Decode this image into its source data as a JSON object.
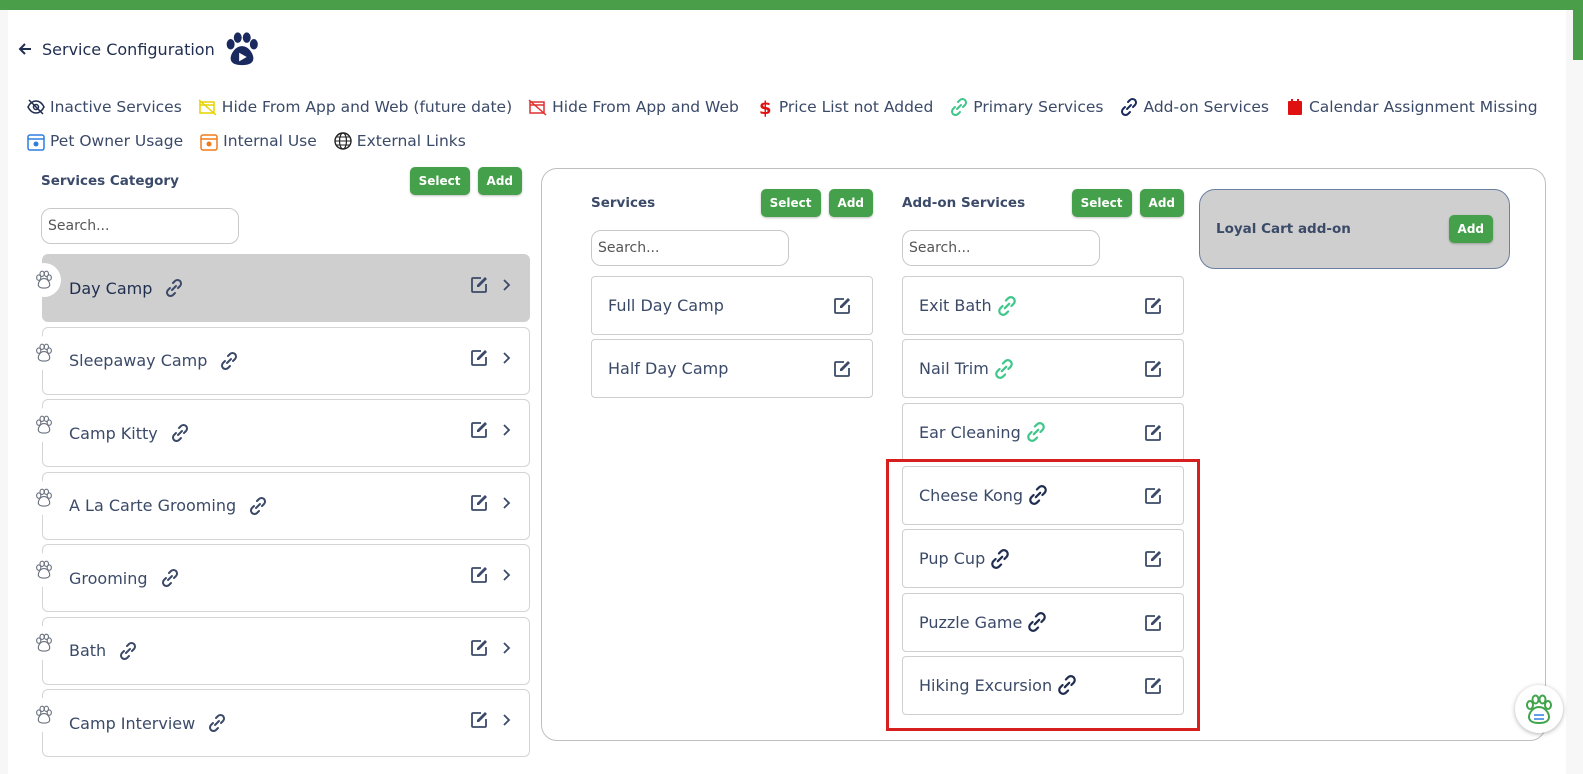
{
  "header": {
    "title": "Service Configuration"
  },
  "legend": {
    "row1": [
      {
        "icon": "eye-slash-icon",
        "label": "Inactive Services"
      },
      {
        "icon": "hide-future-icon",
        "label": "Hide From App and Web (future date)"
      },
      {
        "icon": "hide-app-web-icon",
        "label": "Hide From App and Web"
      },
      {
        "icon": "dollar-icon",
        "label": "Price List not Added"
      },
      {
        "icon": "primary-link-icon",
        "label": "Primary Services"
      },
      {
        "icon": "addon-link-icon",
        "label": "Add-on Services"
      },
      {
        "icon": "calendar-icon",
        "label": "Calendar Assignment Missing"
      }
    ],
    "row2": [
      {
        "icon": "pet-owner-usage-icon",
        "label": "Pet Owner Usage"
      },
      {
        "icon": "internal-use-icon",
        "label": "Internal Use"
      },
      {
        "icon": "globe-icon",
        "label": "External Links"
      }
    ]
  },
  "categories": {
    "title": "Services Category",
    "select_label": "Select",
    "add_label": "Add",
    "search_placeholder": "Search...",
    "items": [
      "Day Camp",
      "Sleepaway Camp",
      "Camp Kitty",
      "A La Carte Grooming",
      "Grooming",
      "Bath",
      "Camp Interview"
    ],
    "active_index": 0
  },
  "services": {
    "title": "Services",
    "select_label": "Select",
    "add_label": "Add",
    "search_placeholder": "Search...",
    "items": [
      "Full Day Camp",
      "Half Day Camp"
    ]
  },
  "addons": {
    "title": "Add-on Services",
    "select_label": "Select",
    "add_label": "Add",
    "search_placeholder": "Search...",
    "items": [
      {
        "label": "Exit Bath",
        "link_type": "primary"
      },
      {
        "label": "Nail Trim",
        "link_type": "primary"
      },
      {
        "label": "Ear Cleaning",
        "link_type": "primary"
      },
      {
        "label": "Cheese Kong",
        "link_type": "addon"
      },
      {
        "label": "Pup Cup",
        "link_type": "addon"
      },
      {
        "label": "Puzzle Game",
        "link_type": "addon"
      },
      {
        "label": "Hiking Excursion",
        "link_type": "addon"
      }
    ]
  },
  "loyal_cart": {
    "label": "Loyal Cart add-on",
    "add_label": "Add"
  },
  "colors": {
    "brand_green": "#4a9e4a",
    "primary_link": "#3fc68a",
    "addon_link": "#1f2d4f",
    "highlight": "#d81f1f"
  }
}
